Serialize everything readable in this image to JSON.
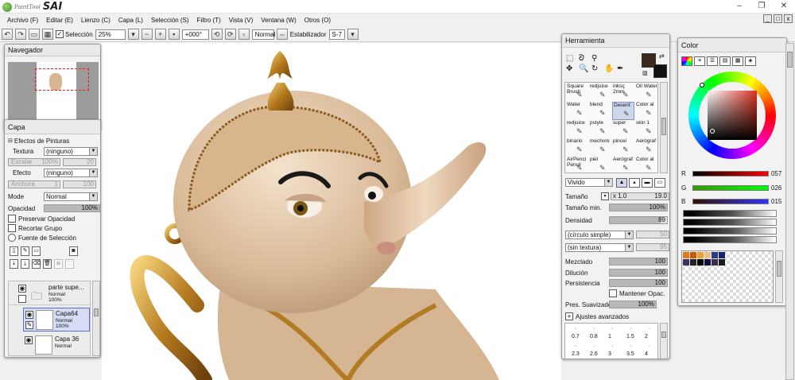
{
  "app": {
    "logo_small": "PaintTool",
    "logo_big": "SAI"
  },
  "window_buttons": {
    "minimize": "–",
    "maximize": "❐",
    "close": "✕"
  },
  "menu": [
    "Archivo (F)",
    "Editar (E)",
    "Lienzo (C)",
    "Capa (L)",
    "Selección (S)",
    "Filtro (T)",
    "Vista (V)",
    "Ventana (W)",
    "Otros (O)"
  ],
  "mdi_buttons": [
    "_",
    "□",
    "x"
  ],
  "toolbar": {
    "selection_label": "Selección",
    "zoom": "25%",
    "rotation": "+000°",
    "blend": "Normal",
    "stabilizer_label": "Estabilizador",
    "stabilizer_value": "S-7"
  },
  "navigator": {
    "title": "Navegador"
  },
  "layer": {
    "title": "Capa",
    "effects_label": "Efectos de Pinturas",
    "texture_label": "Textura",
    "texture_value": "(ninguno)",
    "scale_label": "Escalar",
    "scale_value": "100%",
    "scale_value2": "20",
    "effect_label": "Efecto",
    "effect_value": "(ninguno)",
    "width_label": "Anchura",
    "width_value": "1",
    "width_value2": "100",
    "mode_label": "Mode",
    "mode_value": "Normal",
    "opacity_label": "Opacidad",
    "opacity_value": "100%",
    "opacity_level": 1.0,
    "preserve_opacity": "Preservar Opacidad",
    "clip_group": "Recortar Grupo",
    "selection_source": "Fuente de Selección",
    "layers": [
      {
        "name": "parte supe...",
        "mode": "Normal",
        "opacity": "100%"
      },
      {
        "name": "Capa64",
        "mode": "Normal",
        "opacity": "100%"
      },
      {
        "name": "Capa 36",
        "mode": "Normal",
        "opacity": ""
      }
    ]
  },
  "tools": {
    "title": "Herramienta",
    "main_color": "#3b2a20",
    "brushes": [
      [
        "Square Brush",
        "redjuice",
        "inksç 2mm",
        "Oil Water"
      ],
      [
        "Water",
        "blend",
        "Desenf.",
        "Color al"
      ],
      [
        "redjuice",
        "pstyle",
        "super",
        "skin 1"
      ],
      [
        "binario",
        "mechoni",
        "pincel",
        "Aerógraf"
      ],
      [
        "AirPenci Pencil",
        "piel",
        "Aerógraf",
        "Color al"
      ]
    ],
    "shape_mode": "Vivido",
    "size_label": "Tamaño",
    "size_mult": "x 1.0",
    "size_value": "19.0",
    "min_size_label": "Tamaño min.",
    "min_size_value": "100%",
    "min_size_level": 1.0,
    "density_label": "Densidad",
    "density_value": "89",
    "density_level": 0.89,
    "shape_value": "(círculo simple)",
    "shape_num": "50",
    "texture_value": "(sin textura)",
    "texture_num": "95",
    "blending_label": "Mezclado",
    "blending_value": "100",
    "blending_level": 1.0,
    "dilution_label": "Dilución",
    "dilution_value": "100",
    "dilution_level": 1.0,
    "persistence_label": "Persistencia",
    "persistence_value": "100",
    "persistence_level": 1.0,
    "keep_opacity": "Mantener Opac.",
    "smoothing_label": "Pres. Suavizado",
    "smoothing_value": "100%",
    "smoothing_level": 1.0,
    "advanced": "Ajustes avanzados",
    "tip_sizes_row1": [
      "0.7",
      "0.8",
      "1",
      "1.5",
      "2"
    ],
    "tip_sizes_row2": [
      "2.3",
      "2.6",
      "3",
      "3.5",
      "4"
    ]
  },
  "color": {
    "title": "Color",
    "r_label": "R",
    "r_value": "057",
    "g_label": "G",
    "g_value": "026",
    "b_label": "B",
    "b_value": "015",
    "swatches": [
      "#e07a1a",
      "#c85a10",
      "#f0a030",
      "#e8c090",
      "#2a3a8a",
      "#1a2470",
      "#403060",
      "#222222",
      "#000000",
      "#101040",
      "#3a2a55",
      "#1a1a1a"
    ]
  }
}
